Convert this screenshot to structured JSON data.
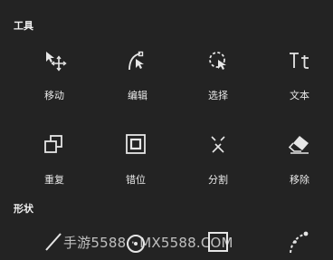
{
  "sections": {
    "tools_title": "工具",
    "shapes_title": "形状"
  },
  "tools": [
    {
      "label": "移动",
      "icon": "move-icon"
    },
    {
      "label": "编辑",
      "icon": "edit-path-icon"
    },
    {
      "label": "选择",
      "icon": "lasso-select-icon"
    },
    {
      "label": "文本",
      "icon": "text-icon"
    },
    {
      "label": "重复",
      "icon": "duplicate-icon"
    },
    {
      "label": "错位",
      "icon": "offset-icon"
    },
    {
      "label": "分割",
      "icon": "split-icon"
    },
    {
      "label": "移除",
      "icon": "eraser-icon"
    }
  ],
  "shapes": [
    {
      "icon": "line-icon"
    },
    {
      "icon": "circle-icon"
    },
    {
      "icon": "rectangle-icon"
    },
    {
      "icon": "curve-icon"
    }
  ],
  "watermark": "手游5588 · MX5588.COM",
  "colors": {
    "background": "#232323",
    "foreground": "#e6e6e6"
  }
}
